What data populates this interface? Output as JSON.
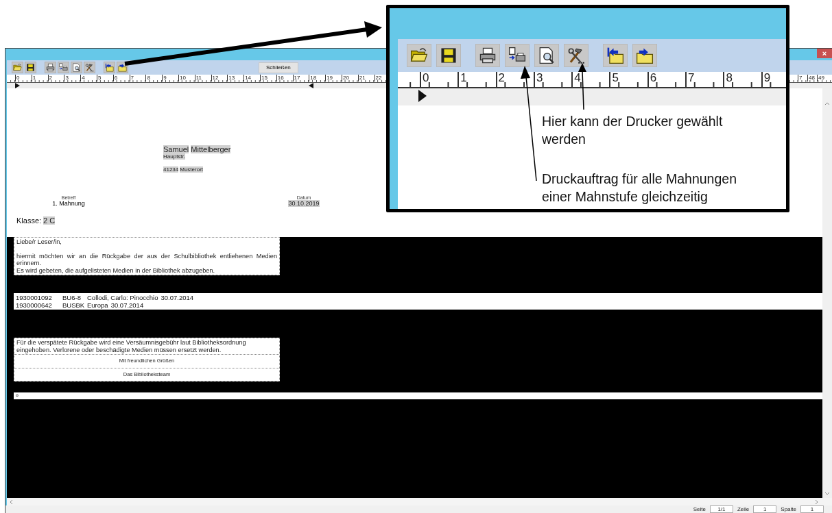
{
  "window": {
    "close_label": "×"
  },
  "toolbar": {
    "groups": [
      [
        {
          "kind": "open"
        },
        {
          "kind": "save"
        }
      ],
      [
        {
          "kind": "print"
        },
        {
          "kind": "print_all"
        },
        {
          "kind": "preview"
        },
        {
          "kind": "tools"
        }
      ],
      [
        {
          "kind": "import"
        },
        {
          "kind": "export"
        }
      ]
    ],
    "close_button": "Schließen"
  },
  "ruler": {
    "labels": [
      "0",
      "1",
      "2",
      "3",
      "4",
      "5",
      "6",
      "7",
      "8",
      "9",
      "10",
      "11",
      "12",
      "13",
      "14",
      "15",
      "16",
      "17",
      "18",
      "19",
      "20",
      "21",
      "22"
    ],
    "right_labels": [
      "7",
      "48",
      "49"
    ]
  },
  "document": {
    "recipient": {
      "first_name": "Samuel",
      "last_name": "Mittelberger",
      "street": "Hauptstr.",
      "zip": "41234",
      "city": "Musterort"
    },
    "subject_label": "Betreff",
    "subject": "1. Mahnung",
    "date_label": "Datum",
    "date": "30.10.2019",
    "class_label": "Klasse:",
    "class_value": "2 C",
    "greeting_line": "Liebe/r Leser/in,",
    "intro": "hiermit möchten wir an die Rückgabe der aus der Schulbibliothek entliehenen Medien erinnern.",
    "request": "Es wird gebeten, die aufgelisteten Medien in der Bibliothek abzugeben.",
    "items": [
      {
        "cells": [
          "1930001092",
          "BU6-8",
          "Collodi, Carlo: Pinocchio",
          "30.07.2014"
        ]
      },
      {
        "cells": [
          "1930000642",
          "BUSBK",
          "Europa",
          "30.07.2014"
        ]
      }
    ],
    "closing": "Für die verspätete Rückgabe wird eine Versäumnisgebühr laut Bibliotheksordnung eingehoben. Verlorene oder beschädigte Medien müssen ersetzt werden.",
    "regards": "Mit freundlichen Grüßen",
    "signature": "Das Bibliotheksteam",
    "end_mark": "¤"
  },
  "status_bar": [
    {
      "label": "Seite",
      "value": "1/1"
    },
    {
      "label": "Zeile",
      "value": "1"
    },
    {
      "label": "Spalte",
      "value": "1"
    }
  ],
  "callout": {
    "groups": [
      [
        {
          "kind": "open"
        },
        {
          "kind": "save"
        }
      ],
      [
        {
          "kind": "print"
        },
        {
          "kind": "print_all"
        },
        {
          "kind": "preview"
        },
        {
          "kind": "tools"
        }
      ],
      [
        {
          "kind": "import"
        },
        {
          "kind": "export"
        }
      ]
    ],
    "ruler_labels": [
      "0",
      "1",
      "2",
      "3",
      "4",
      "5",
      "6",
      "7",
      "8",
      "9"
    ],
    "notes": [
      "Hier kann der Drucker gewählt werden",
      "Druckauftrag für alle Mahnungen einer Mahnstufe gleichzeitig"
    ]
  }
}
